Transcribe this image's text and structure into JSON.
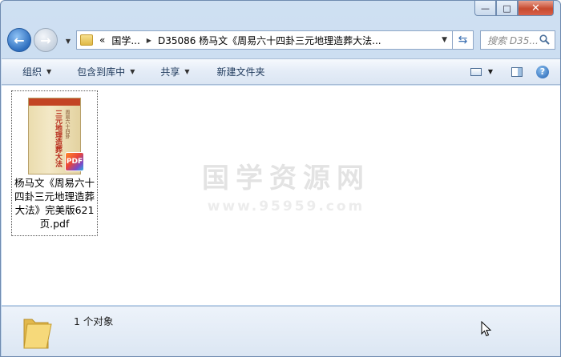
{
  "window": {
    "caption_buttons": {
      "minimize": "—",
      "maximize": "□",
      "close": "✕"
    }
  },
  "navigation": {
    "back_icon": "back-arrow-icon",
    "forward_icon": "forward-arrow-icon",
    "address": {
      "chevrons": "«",
      "segments": [
        "国学...",
        "D35086 杨马文《周易六十四卦三元地理造葬大法..."
      ]
    },
    "search_placeholder": "搜索 D35..."
  },
  "toolbar": {
    "organize": "组织",
    "include_in_library": "包含到库中",
    "share": "共享",
    "new_folder": "新建文件夹"
  },
  "watermark": {
    "title": "国学资源网",
    "url": "www.95959.com"
  },
  "files": [
    {
      "name": "杨马文《周易六十四卦三元地理造葬大法》完美版621页.pdf",
      "thumbnail_title": "三元地理造葬大法",
      "thumbnail_subtitle": "周易六十四卦",
      "badge": "PDF"
    }
  ],
  "status": {
    "count_text": "1 个对象"
  },
  "colors": {
    "accent": "#2f6fbf",
    "toolbar_text": "#1e395b",
    "close_button": "#c74a2f"
  }
}
